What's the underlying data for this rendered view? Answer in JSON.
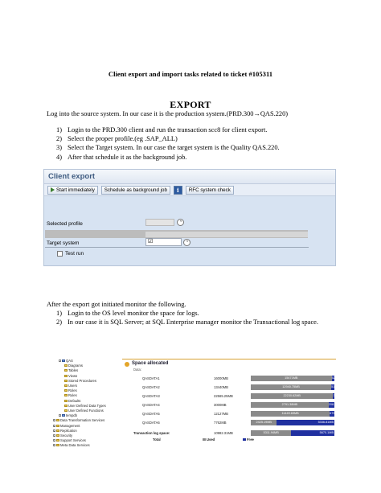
{
  "document": {
    "title": "Client export and import tasks related to ticket #105311",
    "section_title": "EXPORT",
    "intro": "Log into the source system. In our case it is the production system.(PRD.300→QAS.220)",
    "steps": [
      {
        "num": "1)",
        "text": "Login to the PRD.300 client and run the transaction scc8 for client export."
      },
      {
        "num": "2)",
        "text": "Select the proper profile.(eg .SAP_ALL)"
      },
      {
        "num": "3)",
        "text": "Select the Target system. In our case the target system is the Quality QAS.220."
      },
      {
        "num": "4)",
        "text": "After that schedule it as the background job."
      }
    ],
    "after_text": "After the export got initiated monitor the following.",
    "monitor_steps": [
      {
        "num": "1)",
        "text": "Login to the OS level monitor the space for logs."
      },
      {
        "num": "2)",
        "text": "In our case it is SQL Server; at SQL Enterprise manager monitor the Transactional log space."
      }
    ]
  },
  "sap_screen": {
    "title": "Client export",
    "toolbar": {
      "start_immediately": "Start immediately",
      "schedule_background": "Schedule as background job",
      "info_icon_text": "i",
      "rfc_check": "RFC system check"
    },
    "selected_profile_label": "Selected profile",
    "target_system_label": "Target system",
    "target_system_value": "☑",
    "test_run_label": "Test run",
    "test_run_checked": false
  },
  "enterprise_manager": {
    "tree": [
      {
        "label": "QAS",
        "level": 1,
        "expanded": true
      },
      {
        "label": "Diagrams",
        "level": 2
      },
      {
        "label": "Tables",
        "level": 2
      },
      {
        "label": "Views",
        "level": 2
      },
      {
        "label": "Stored Procedures",
        "level": 2
      },
      {
        "label": "Users",
        "level": 2
      },
      {
        "label": "Roles",
        "level": 2
      },
      {
        "label": "Rules",
        "level": 2
      },
      {
        "label": "Defaults",
        "level": 2
      },
      {
        "label": "User Defined Data Types",
        "level": 2
      },
      {
        "label": "User Defined Functions",
        "level": 2
      },
      {
        "label": "tempdb",
        "level": 1
      },
      {
        "label": "Data Transformation Services",
        "level": 0
      },
      {
        "label": "Management",
        "level": 0
      },
      {
        "label": "Replication",
        "level": 0
      },
      {
        "label": "Security",
        "level": 0
      },
      {
        "label": "Support Services",
        "level": 0
      },
      {
        "label": "Meta Data Services",
        "level": 0
      }
    ],
    "panel_title": "Space allocated",
    "data_label": "Data:",
    "files": [
      {
        "name": "QASDATA1",
        "size": "16000MB",
        "used": "15471MB",
        "free": "529MB",
        "used_fraction": 0.967
      },
      {
        "name": "QASDATA2",
        "size": "13440MB",
        "used": "12940.75MB",
        "free": "519.25MB",
        "used_fraction": 0.962
      },
      {
        "name": "QASDATA3",
        "size": "22565.25MB",
        "used": "22230.62MB",
        "free": "334.63MB",
        "used_fraction": 0.985
      },
      {
        "name": "QASDATA4",
        "size": "3000MB",
        "used": "2791.38MB",
        "free": "208.62MB",
        "used_fraction": 0.93
      },
      {
        "name": "QASDATA5",
        "size": "12127MB",
        "used": "11449.69MB",
        "free": "679.31MB",
        "used_fraction": 0.944
      },
      {
        "name": "QASDATA6",
        "size": "7762MB",
        "used": "2425.19MB",
        "free": "5336.81MB",
        "used_fraction": 0.312
      }
    ],
    "log_label": "Transaction log space:",
    "log": {
      "size": "10982.31MB",
      "used": "5311.94MB",
      "free": "5670.1MB",
      "used_fraction": 0.484
    },
    "legend": {
      "total": "Total",
      "used": "Used",
      "free": "Free"
    },
    "colors": {
      "used": "#8a8a8a",
      "free": "#2030a0"
    }
  }
}
